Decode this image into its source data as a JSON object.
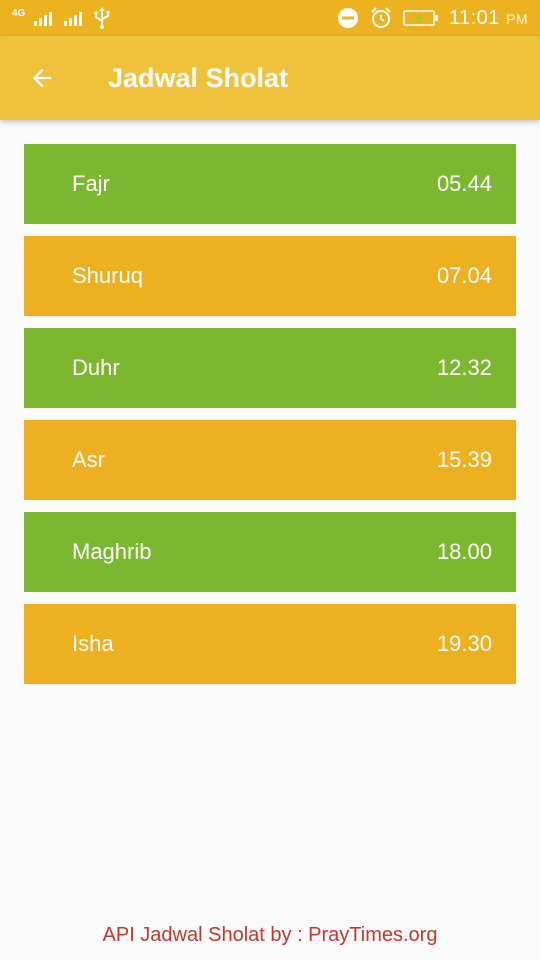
{
  "status_bar": {
    "network_label": "4G",
    "time": "11:01",
    "ampm": "PM",
    "icons": [
      "signal-icon",
      "signal-icon",
      "usb-icon",
      "do-not-disturb-icon",
      "alarm-icon",
      "battery-charging-icon"
    ]
  },
  "app_bar": {
    "title": "Jadwal Sholat",
    "back_icon": "arrow-back-icon"
  },
  "prayers": [
    {
      "name": "Fajr",
      "time": "05.44",
      "color": "#7CB82F"
    },
    {
      "name": "Shuruq",
      "time": "07.04",
      "color": "#ECB021"
    },
    {
      "name": "Duhr",
      "time": "12.32",
      "color": "#7CB82F"
    },
    {
      "name": "Asr",
      "time": "15.39",
      "color": "#ECB021"
    },
    {
      "name": "Maghrib",
      "time": "18.00",
      "color": "#7CB82F"
    },
    {
      "name": "Isha",
      "time": "19.30",
      "color": "#ECB021"
    }
  ],
  "footer": {
    "credit": "API Jadwal Sholat by : PrayTimes.org"
  },
  "colors": {
    "status_bar": "#EDB220",
    "app_bar": "#F0C13A",
    "green_row": "#7CB82F",
    "amber_row": "#ECB021",
    "footer_text": "#C0392B",
    "background": "#FAFAFA"
  }
}
